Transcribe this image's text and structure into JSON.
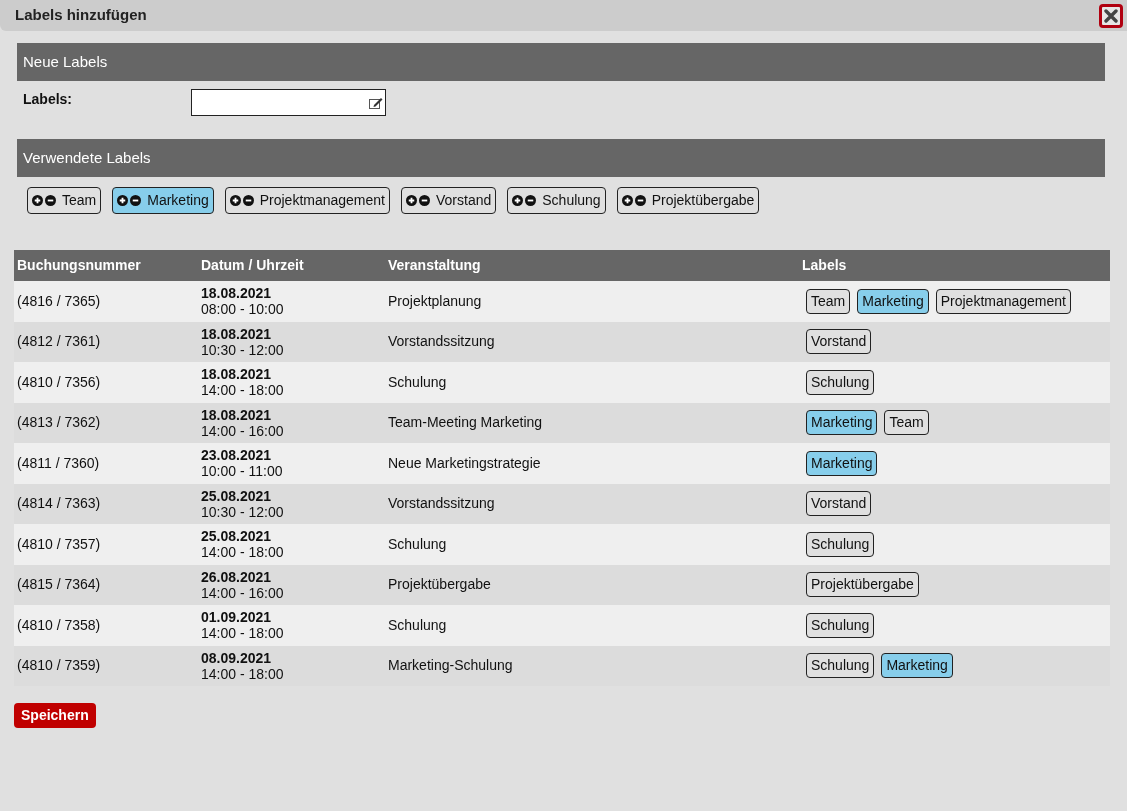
{
  "window": {
    "title": "Labels hinzufügen"
  },
  "new_labels": {
    "heading": "Neue Labels",
    "field_label": "Labels:"
  },
  "used_labels": {
    "heading": "Verwendete Labels",
    "labels": [
      {
        "text": "Team",
        "selected": false
      },
      {
        "text": "Marketing",
        "selected": true
      },
      {
        "text": "Projektmanagement",
        "selected": false
      },
      {
        "text": "Vorstand",
        "selected": false
      },
      {
        "text": "Schulung",
        "selected": false
      },
      {
        "text": "Projektübergabe",
        "selected": false
      }
    ]
  },
  "table": {
    "columns": [
      "Buchungsnummer",
      "Datum / Uhrzeit",
      "Veranstaltung",
      "Labels"
    ],
    "rows": [
      {
        "booking": "(4816 / 7365)",
        "date": "18.08.2021",
        "time": "08:00 - 10:00",
        "event": "Projektplanung",
        "labels": [
          {
            "text": "Team",
            "selected": false
          },
          {
            "text": "Marketing",
            "selected": true
          },
          {
            "text": "Projektmanagement",
            "selected": false
          }
        ]
      },
      {
        "booking": "(4812 / 7361)",
        "date": "18.08.2021",
        "time": "10:30 - 12:00",
        "event": "Vorstandssitzung",
        "labels": [
          {
            "text": "Vorstand",
            "selected": false
          }
        ]
      },
      {
        "booking": "(4810 / 7356)",
        "date": "18.08.2021",
        "time": "14:00 - 18:00",
        "event": "Schulung",
        "labels": [
          {
            "text": "Schulung",
            "selected": false
          }
        ]
      },
      {
        "booking": "(4813 / 7362)",
        "date": "18.08.2021",
        "time": "14:00 - 16:00",
        "event": "Team-Meeting Marketing",
        "labels": [
          {
            "text": "Marketing",
            "selected": true
          },
          {
            "text": "Team",
            "selected": false
          }
        ]
      },
      {
        "booking": "(4811 / 7360)",
        "date": "23.08.2021",
        "time": "10:00 - 11:00",
        "event": "Neue Marketingstrategie",
        "labels": [
          {
            "text": "Marketing",
            "selected": true
          }
        ]
      },
      {
        "booking": "(4814 / 7363)",
        "date": "25.08.2021",
        "time": "10:30 - 12:00",
        "event": "Vorstandssitzung",
        "labels": [
          {
            "text": "Vorstand",
            "selected": false
          }
        ]
      },
      {
        "booking": "(4810 / 7357)",
        "date": "25.08.2021",
        "time": "14:00 - 18:00",
        "event": "Schulung",
        "labels": [
          {
            "text": "Schulung",
            "selected": false
          }
        ]
      },
      {
        "booking": "(4815 / 7364)",
        "date": "26.08.2021",
        "time": "14:00 - 16:00",
        "event": "Projektübergabe",
        "labels": [
          {
            "text": "Projektübergabe",
            "selected": false
          }
        ]
      },
      {
        "booking": "(4810 / 7358)",
        "date": "01.09.2021",
        "time": "14:00 - 18:00",
        "event": "Schulung",
        "labels": [
          {
            "text": "Schulung",
            "selected": false
          }
        ]
      },
      {
        "booking": "(4810 / 7359)",
        "date": "08.09.2021",
        "time": "14:00 - 18:00",
        "event": "Marketing-Schulung",
        "labels": [
          {
            "text": "Schulung",
            "selected": false
          },
          {
            "text": "Marketing",
            "selected": true
          }
        ]
      }
    ]
  },
  "save_button": "Speichern"
}
